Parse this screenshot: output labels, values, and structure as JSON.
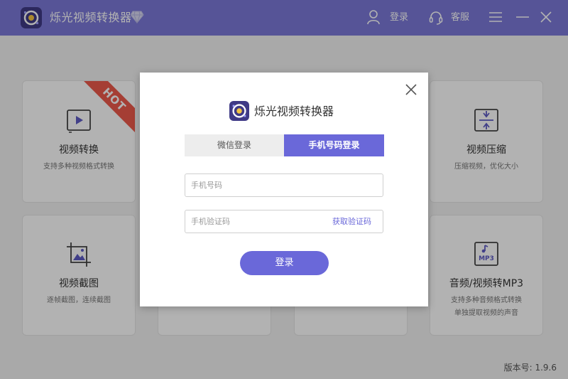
{
  "app": {
    "title": "烁光视频转换器"
  },
  "titlebar": {
    "login_label": "登录",
    "service_label": "客服"
  },
  "cards": [
    {
      "title": "视频转换",
      "desc": "支持多种视频格式转换",
      "badge": "HOT"
    },
    {
      "title": "视频压缩",
      "desc": "压缩视频，优化大小"
    },
    {
      "title": "视频截图",
      "desc": "逐帧截图，连续截图"
    },
    {
      "title": "音频/视频转MP3",
      "desc": "支持多种音频格式转换",
      "desc2": "单独提取视频的声音",
      "icon_text": "MP3"
    }
  ],
  "version": "版本号: 1.9.6",
  "modal": {
    "title": "烁光视频转换器",
    "tabs": [
      {
        "label": "微信登录",
        "active": false
      },
      {
        "label": "手机号码登录",
        "active": true
      }
    ],
    "phone": {
      "placeholder": "手机号码",
      "value": ""
    },
    "code": {
      "placeholder": "手机验证码",
      "value": ""
    },
    "get_code_label": "获取验证码",
    "login_label": "登录"
  },
  "colors": {
    "accent": "#6a68d9",
    "titlebar": "#7b79d8",
    "hot": "#ec5a4b"
  }
}
